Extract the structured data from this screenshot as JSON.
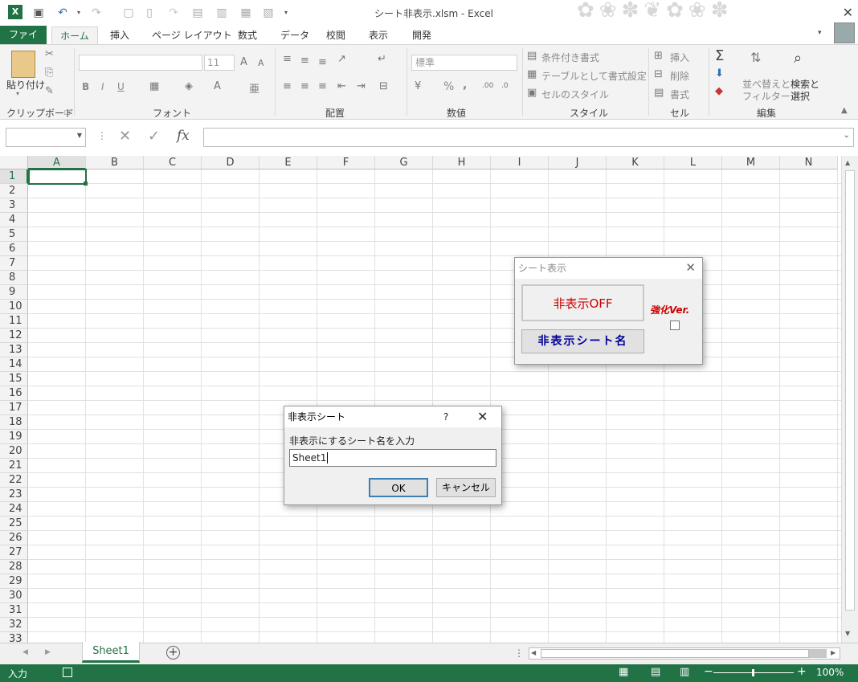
{
  "window": {
    "title": "シート非表示.xlsm - Excel"
  },
  "qat": {
    "undo_icon": "undo-icon",
    "redo_icon": "redo-icon"
  },
  "tabs": [
    "ファイル",
    "ホーム",
    "挿入",
    "ページ レイアウト",
    "数式",
    "データ",
    "校閲",
    "表示",
    "開発"
  ],
  "ribbon": {
    "clipboard": {
      "paste": "貼り付け",
      "label": "クリップボード"
    },
    "font": {
      "size": "11",
      "bold": "B",
      "italic": "I",
      "underline": "U",
      "label": "フォント"
    },
    "alignment": {
      "label": "配置"
    },
    "number": {
      "format": "標準",
      "percent": "%",
      "comma": ",",
      "label": "数値"
    },
    "styles": {
      "conditional": "条件付き書式",
      "table": "テーブルとして書式設定",
      "cell_style": "セルのスタイル",
      "label": "スタイル"
    },
    "cells": {
      "insert": "挿入",
      "delete": "削除",
      "format": "書式",
      "label": "セル"
    },
    "editing": {
      "sort_line1": "並べ替えと",
      "sort_line2": "フィルター",
      "find_line1": "検索と",
      "find_line2": "選択",
      "label": "編集"
    }
  },
  "formula_bar": {
    "fx": "fx",
    "value": ""
  },
  "grid": {
    "columns": [
      "A",
      "B",
      "C",
      "D",
      "E",
      "F",
      "G",
      "H",
      "I",
      "J",
      "K",
      "L",
      "M",
      "N"
    ],
    "rows": [
      "1",
      "2",
      "3",
      "4",
      "5",
      "6",
      "7",
      "8",
      "9",
      "10",
      "11",
      "12",
      "13",
      "14",
      "15",
      "16",
      "17",
      "18",
      "19",
      "20",
      "21",
      "22",
      "23",
      "24",
      "25",
      "26",
      "27",
      "28",
      "29",
      "30",
      "31",
      "32",
      "33"
    ],
    "selected": "A1"
  },
  "sheet_tabs": {
    "active": "Sheet1"
  },
  "status_bar": {
    "mode": "入力",
    "zoom": "100%"
  },
  "form_dialog": {
    "title": "シート表示",
    "toggle_button": "非表示OFF",
    "hidden_names_button": "非表示シート名",
    "strong_label": "強化Ver.",
    "strong_checked": false
  },
  "input_dialog": {
    "title": "非表示シート",
    "help": "?",
    "prompt": "非表示にするシート名を入力",
    "value": "Sheet1",
    "ok": "OK",
    "cancel": "キャンセル"
  },
  "colors": {
    "excel_green": "#217346",
    "dialog_red": "#cc0000",
    "dialog_blue": "#000099"
  }
}
